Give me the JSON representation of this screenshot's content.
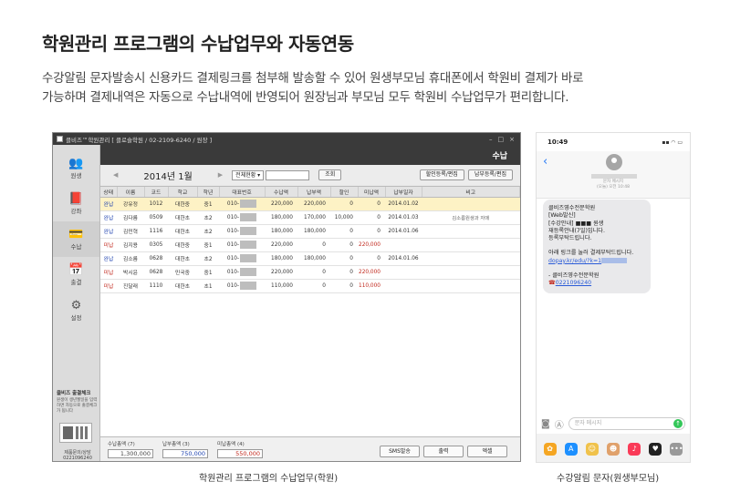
{
  "header": {
    "title": "학원관리 프로그램의 수납업무와 자동연동",
    "description_line1": "수강알림 문자발송시 신용카드 결제링크를 첨부해 발송할 수 있어 원생부모님 휴대폰에서 학원비 결제가 바로",
    "description_line2": "가능하며 결제내역은 자동으로 수납내역에 반영되어 원장님과 부모님 모두 학원비 수납업무가 편리합니다."
  },
  "app": {
    "window_title": "클비즈™학원관리 [ 클로슬학원 / 02-2109-6240 / 원장 ]",
    "win_controls": [
      "–",
      "□",
      "×"
    ],
    "section_title": "수납",
    "sidebar": [
      {
        "icon": "students-icon",
        "glyph": "👥",
        "label": "원생"
      },
      {
        "icon": "lecture-icon",
        "glyph": "📕",
        "label": "강좌"
      },
      {
        "icon": "payment-icon",
        "glyph": "💳",
        "label": "수납"
      },
      {
        "icon": "calendar-icon",
        "glyph": "📅",
        "label": "출결"
      },
      {
        "icon": "settings-icon",
        "glyph": "⚙",
        "label": "설정"
      }
    ],
    "side_promo_title": "클비즈 출결체크",
    "side_promo_text": "원생이 생년월일을 입력하면 자동으로 출결체크가 됩니다",
    "side_contact": "제품문의/상담 0221096240",
    "toolbar": {
      "prev": "◀",
      "year_month": "2014년 1월",
      "next": "▶",
      "filter_select": "전체현황",
      "search_button": "조회",
      "discount_button": "할인등록/편집",
      "payment_button": "납부등록/편집"
    },
    "columns": [
      "상태",
      "이름",
      "코드",
      "학교",
      "학년",
      "대표번호",
      "수납액",
      "납부액",
      "할인",
      "미납액",
      "납부일자",
      "비고"
    ],
    "rows": [
      {
        "status": "완납",
        "name": "강유정",
        "code": "1012",
        "school": "대한중",
        "grade": "중1",
        "phone": "010-",
        "fee": "220,000",
        "paid": "220,000",
        "discount": "0",
        "unpaid": "0",
        "date": "2014.01.02",
        "memo": ""
      },
      {
        "status": "완납",
        "name": "김다름",
        "code": "0509",
        "school": "대한초",
        "grade": "초2",
        "phone": "010-",
        "fee": "180,000",
        "paid": "170,000",
        "discount": "10,000",
        "unpaid": "0",
        "date": "2014.01.03",
        "memo": "김소름원생과 자매"
      },
      {
        "status": "완납",
        "name": "김민혁",
        "code": "1116",
        "school": "대한초",
        "grade": "초2",
        "phone": "010-",
        "fee": "180,000",
        "paid": "180,000",
        "discount": "0",
        "unpaid": "0",
        "date": "2014.01.06",
        "memo": ""
      },
      {
        "status": "미납",
        "name": "김지용",
        "code": "0305",
        "school": "대한중",
        "grade": "중1",
        "phone": "010-",
        "fee": "220,000",
        "paid": "0",
        "discount": "0",
        "unpaid": "220,000",
        "date": "",
        "memo": ""
      },
      {
        "status": "완납",
        "name": "김소름",
        "code": "0628",
        "school": "대한초",
        "grade": "초2",
        "phone": "010-",
        "fee": "180,000",
        "paid": "180,000",
        "discount": "0",
        "unpaid": "0",
        "date": "2014.01.06",
        "memo": ""
      },
      {
        "status": "미납",
        "name": "박시윤",
        "code": "0628",
        "school": "민국중",
        "grade": "중1",
        "phone": "010-",
        "fee": "220,000",
        "paid": "0",
        "discount": "0",
        "unpaid": "220,000",
        "date": "",
        "memo": ""
      },
      {
        "status": "미납",
        "name": "진달래",
        "code": "1110",
        "school": "대한초",
        "grade": "초1",
        "phone": "010-",
        "fee": "110,000",
        "paid": "0",
        "discount": "0",
        "unpaid": "110,000",
        "date": "",
        "memo": ""
      }
    ],
    "totals": {
      "fee_label": "수납총액 (7)",
      "fee_value": "1,300,000",
      "paid_label": "납부총액 (3)",
      "paid_value": "750,000",
      "unpaid_label": "미납총액 (4)",
      "unpaid_value": "550,000"
    },
    "bottom_buttons": {
      "sms": "SMS발송",
      "print": "출력",
      "excel": "엑셀"
    }
  },
  "captions": {
    "app": "학원관리 프로그램의 수납업무(학원)",
    "phone": "수강알림 문자(원생부모님)"
  },
  "phone": {
    "time": "10:49",
    "status_icons": "▪▪ ◠ ▭",
    "back": "‹",
    "meta_line1": "문자 메시지",
    "meta_line2": "(오늘) 오전 10:48",
    "bubble": {
      "line1": "클비즈영수전문학원",
      "line2": "[Web발신]",
      "line3": "[수강안내] ■■■ 원생",
      "line4": "재등록안내(7일)입니다.",
      "line5": "등록부탁드립니다.",
      "line6": "아래 링크를 눌러 결제부탁드립니다.",
      "link": "dopay.kr/edu/?k=1",
      "sign": "- 클비즈영수전문학원",
      "tel": "0221096240"
    },
    "input_placeholder": "문자 메시지",
    "apps": [
      {
        "icon": "photos-icon",
        "glyph": "✿",
        "color": "#f5a623"
      },
      {
        "icon": "appstore-icon",
        "glyph": "A",
        "color": "#1e90ff"
      },
      {
        "icon": "memoji-icon",
        "glyph": "☺",
        "color": "#f0c24b"
      },
      {
        "icon": "memoji2-icon",
        "glyph": "☻",
        "color": "#e0a16b"
      },
      {
        "icon": "music-icon",
        "glyph": "♪",
        "color": "#fa3b58"
      },
      {
        "icon": "heart-icon",
        "glyph": "♥",
        "color": "#222"
      },
      {
        "icon": "more-icon",
        "glyph": "•••",
        "color": "#999"
      }
    ]
  }
}
